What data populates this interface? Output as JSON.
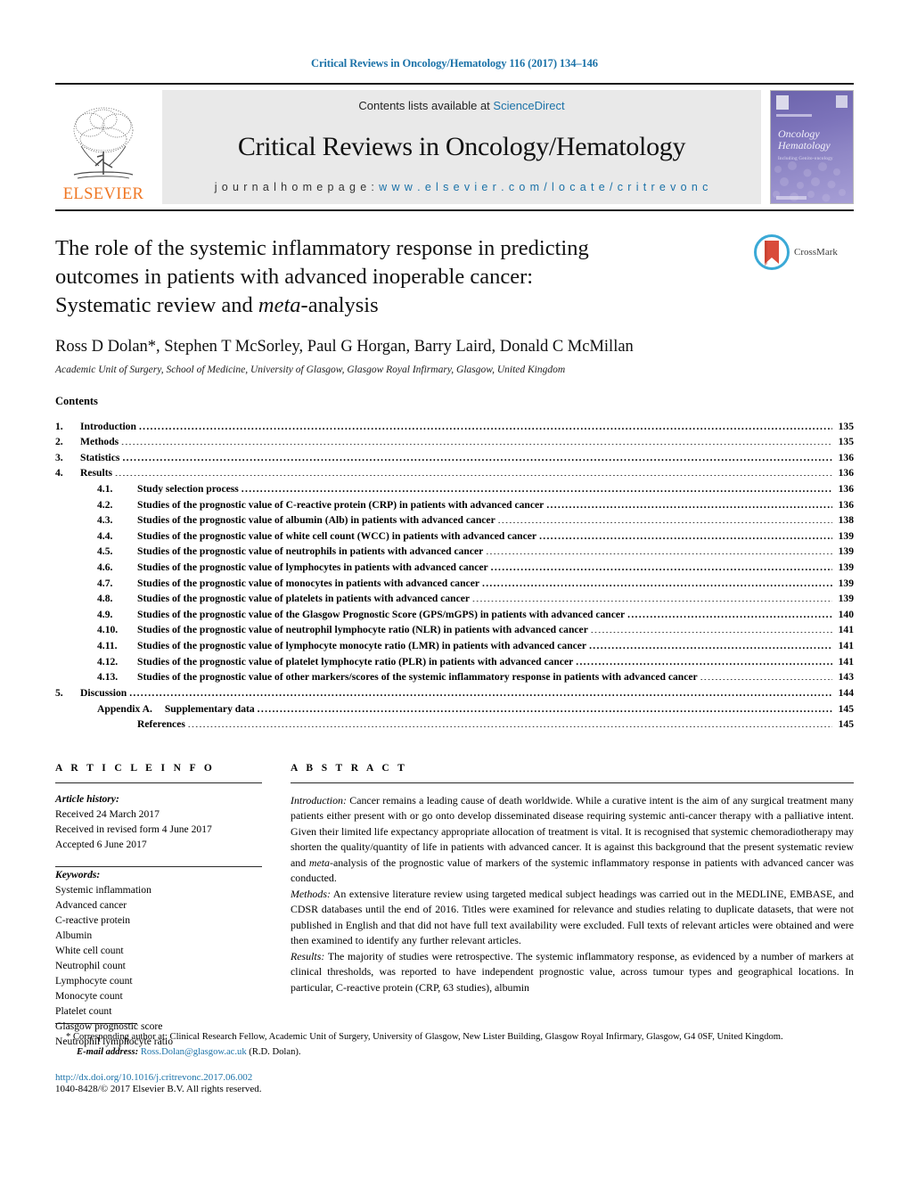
{
  "header": {
    "running_head": "Critical Reviews in Oncology/Hematology 116 (2017) 134–146",
    "contents_line": "Contents lists available at ",
    "sciencedirect": "ScienceDirect",
    "journal_name": "Critical Reviews in Oncology/Hematology",
    "homepage_label": "j o u r n a l   h o m e p a g e :  ",
    "homepage_url": "w w w . e l s e v i e r . c o m / l o c a t e / c r i t r e v o n c",
    "publisher": "ELSEVIER",
    "cover": {
      "title_line1": "Oncology",
      "title_line2": "Hematology",
      "subtitle": "Including Genito-oncology"
    }
  },
  "article": {
    "title_line1": "The role of the systemic inflammatory response in predicting",
    "title_line2": "outcomes in patients with advanced inoperable cancer:",
    "title_line3_a": "Systematic review and ",
    "title_line3_em": "meta",
    "title_line3_b": "-analysis",
    "authors": "Ross D Dolan*, Stephen T McSorley, Paul G Horgan, Barry Laird, Donald C McMillan",
    "affiliation": "Academic Unit of Surgery, School of Medicine, University of Glasgow, Glasgow Royal Infirmary, Glasgow, United Kingdom",
    "crossmark_label": "CrossMark"
  },
  "contents": {
    "heading": "Contents",
    "entries": [
      {
        "level": 1,
        "num": "1.",
        "label": "Introduction",
        "page": "135"
      },
      {
        "level": 1,
        "num": "2.",
        "label": "Methods",
        "page": "135"
      },
      {
        "level": 1,
        "num": "3.",
        "label": "Statistics",
        "page": "136"
      },
      {
        "level": 1,
        "num": "4.",
        "label": "Results",
        "page": "136"
      },
      {
        "level": 2,
        "num": "4.1.",
        "label": "Study selection process",
        "page": "136"
      },
      {
        "level": 2,
        "num": "4.2.",
        "label": "Studies of the prognostic value of C-reactive protein (CRP) in patients with advanced cancer",
        "page": "136"
      },
      {
        "level": 2,
        "num": "4.3.",
        "label": "Studies of the prognostic value of albumin (Alb) in patients with advanced cancer",
        "page": "138"
      },
      {
        "level": 2,
        "num": "4.4.",
        "label": "Studies of the prognostic value of white cell count (WCC) in patients with advanced cancer",
        "page": "139"
      },
      {
        "level": 2,
        "num": "4.5.",
        "label": "Studies of the prognostic value of neutrophils in patients with advanced cancer",
        "page": "139"
      },
      {
        "level": 2,
        "num": "4.6.",
        "label": "Studies of the prognostic value of lymphocytes in patients with advanced cancer",
        "page": "139"
      },
      {
        "level": 2,
        "num": "4.7.",
        "label": "Studies of the prognostic value of monocytes in patients with advanced cancer",
        "page": "139"
      },
      {
        "level": 2,
        "num": "4.8.",
        "label": "Studies of the prognostic value of platelets in patients with advanced cancer",
        "page": "139"
      },
      {
        "level": 2,
        "num": "4.9.",
        "label": "Studies of the prognostic value of the Glasgow Prognostic Score (GPS/mGPS) in patients with advanced cancer",
        "page": "140"
      },
      {
        "level": 2,
        "num": "4.10.",
        "label": "Studies of the prognostic value of neutrophil lymphocyte ratio (NLR) in patients with advanced cancer",
        "page": "141"
      },
      {
        "level": 2,
        "num": "4.11.",
        "label": "Studies of the prognostic value of lymphocyte monocyte ratio (LMR) in patients with advanced cancer",
        "page": "141"
      },
      {
        "level": 2,
        "num": "4.12.",
        "label": "Studies of the prognostic value of platelet lymphocyte ratio (PLR) in patients with advanced cancer",
        "page": "141"
      },
      {
        "level": 2,
        "num": "4.13.",
        "label": "Studies of the prognostic value of other markers/scores of the systemic inflammatory response in patients with advanced cancer",
        "page": "143"
      },
      {
        "level": 1,
        "num": "5.",
        "label": "Discussion",
        "page": "144"
      },
      {
        "level": 2,
        "num": "Appendix A.",
        "label": "Supplementary data",
        "page": "145",
        "appendix": true
      },
      {
        "level": 2,
        "num": "",
        "label": "References",
        "page": "145",
        "noNum": true
      }
    ]
  },
  "article_info": {
    "heading": "A R T I C L E  I N F O",
    "history_label": "Article history:",
    "history": [
      "Received 24 March 2017",
      "Received in revised form 4 June 2017",
      "Accepted 6 June 2017"
    ],
    "keywords_label": "Keywords:",
    "keywords": [
      "Systemic inflammation",
      "Advanced cancer",
      "C-reactive protein",
      "Albumin",
      "White cell count",
      "Neutrophil count",
      "Lymphocyte count",
      "Monocyte count",
      "Platelet count",
      "Glasgow prognostic score",
      "Neutrophil lymphocyte ratio"
    ]
  },
  "abstract": {
    "heading": "A B S T R A C T",
    "intro_label": "Introduction:",
    "intro_text": " Cancer remains a leading cause of death worldwide. While a curative intent is the aim of any surgical treatment many patients either present with or go onto develop disseminated disease requiring systemic anti-cancer therapy with a palliative intent. Given their limited life expectancy appropriate allocation of treatment is vital. It is recognised that systemic chemoradiotherapy may shorten the quality/quantity of life in patients with advanced cancer. It is against this background that the present systematic review and ",
    "intro_em": "meta",
    "intro_text2": "-analysis of the prognostic value of markers of the systemic inflammatory response in patients with advanced cancer was conducted.",
    "methods_label": "Methods:",
    "methods_text": " An extensive literature review using targeted medical subject headings was carried out in the MEDLINE, EMBASE, and CDSR databases until the end of 2016. Titles were examined for relevance and studies relating to duplicate datasets, that were not published in English and that did not have full text availability were excluded. Full texts of relevant articles were obtained and were then examined to identify any further relevant articles.",
    "results_label": "Results:",
    "results_text": " The majority of studies were retrospective. The systemic inflammatory response, as evidenced by a number of markers at clinical thresholds, was reported to have independent prognostic value, across tumour types and geographical locations. In particular, C-reactive protein (CRP, 63 studies), albumin"
  },
  "footer": {
    "corresponding_star": "*",
    "corresponding": " Corresponding author at: Clinical Research Fellow, Academic Unit of Surgery, University of Glasgow, New Lister Building, Glasgow Royal Infirmary, Glasgow, G4 0SF, United Kingdom.",
    "email_label": "E-mail address:",
    "email": "Ross.Dolan@glasgow.ac.uk",
    "email_suffix": " (R.D. Dolan).",
    "doi": "http://dx.doi.org/10.1016/j.critrevonc.2017.06.002",
    "copyright": "1040-8428/© 2017 Elsevier B.V. All rights reserved."
  },
  "colors": {
    "link": "#1b72a8",
    "elsevier_orange": "#ef7622",
    "band_grey": "#e9e9e9",
    "cover_purple": "#7d74bb"
  }
}
